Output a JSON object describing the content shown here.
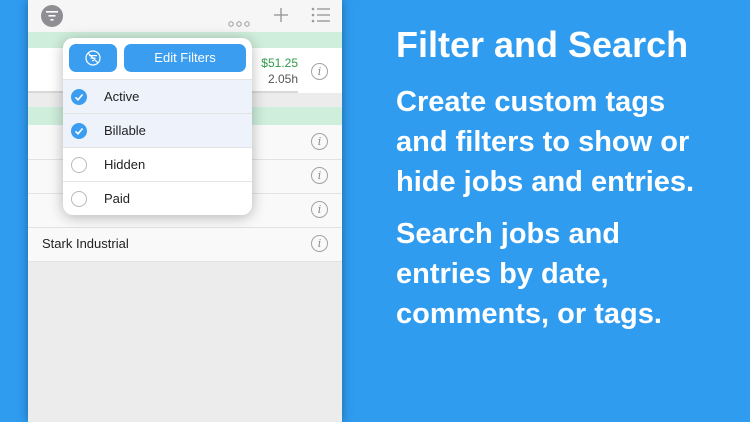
{
  "promo": {
    "headline": "Filter and Search",
    "lines1": [
      "Create custom tags",
      "and filters to show or",
      "hide jobs and entries."
    ],
    "lines2": [
      "Search jobs and",
      "entries by date,",
      "comments, or tags."
    ]
  },
  "toolbar": {
    "filter_icon": "filter-icon",
    "more_icon": "ellipsis-icon",
    "add_icon": "plus-icon",
    "list_icon": "list-icon"
  },
  "job": {
    "amount": "$51.25",
    "hours": "2.05h"
  },
  "rows": [
    {
      "label": ""
    },
    {
      "label": ""
    },
    {
      "label": ""
    },
    {
      "label": "Stark Industrial"
    }
  ],
  "popover": {
    "edit_label": "Edit Filters",
    "options": [
      {
        "label": "Active",
        "checked": true
      },
      {
        "label": "Billable",
        "checked": true
      },
      {
        "label": "Hidden",
        "checked": false
      },
      {
        "label": "Paid",
        "checked": false
      }
    ]
  },
  "colors": {
    "background": "#2f9cf0",
    "accent": "#3b9df0",
    "money": "#2e9a4a",
    "band": "#cfeedb"
  }
}
